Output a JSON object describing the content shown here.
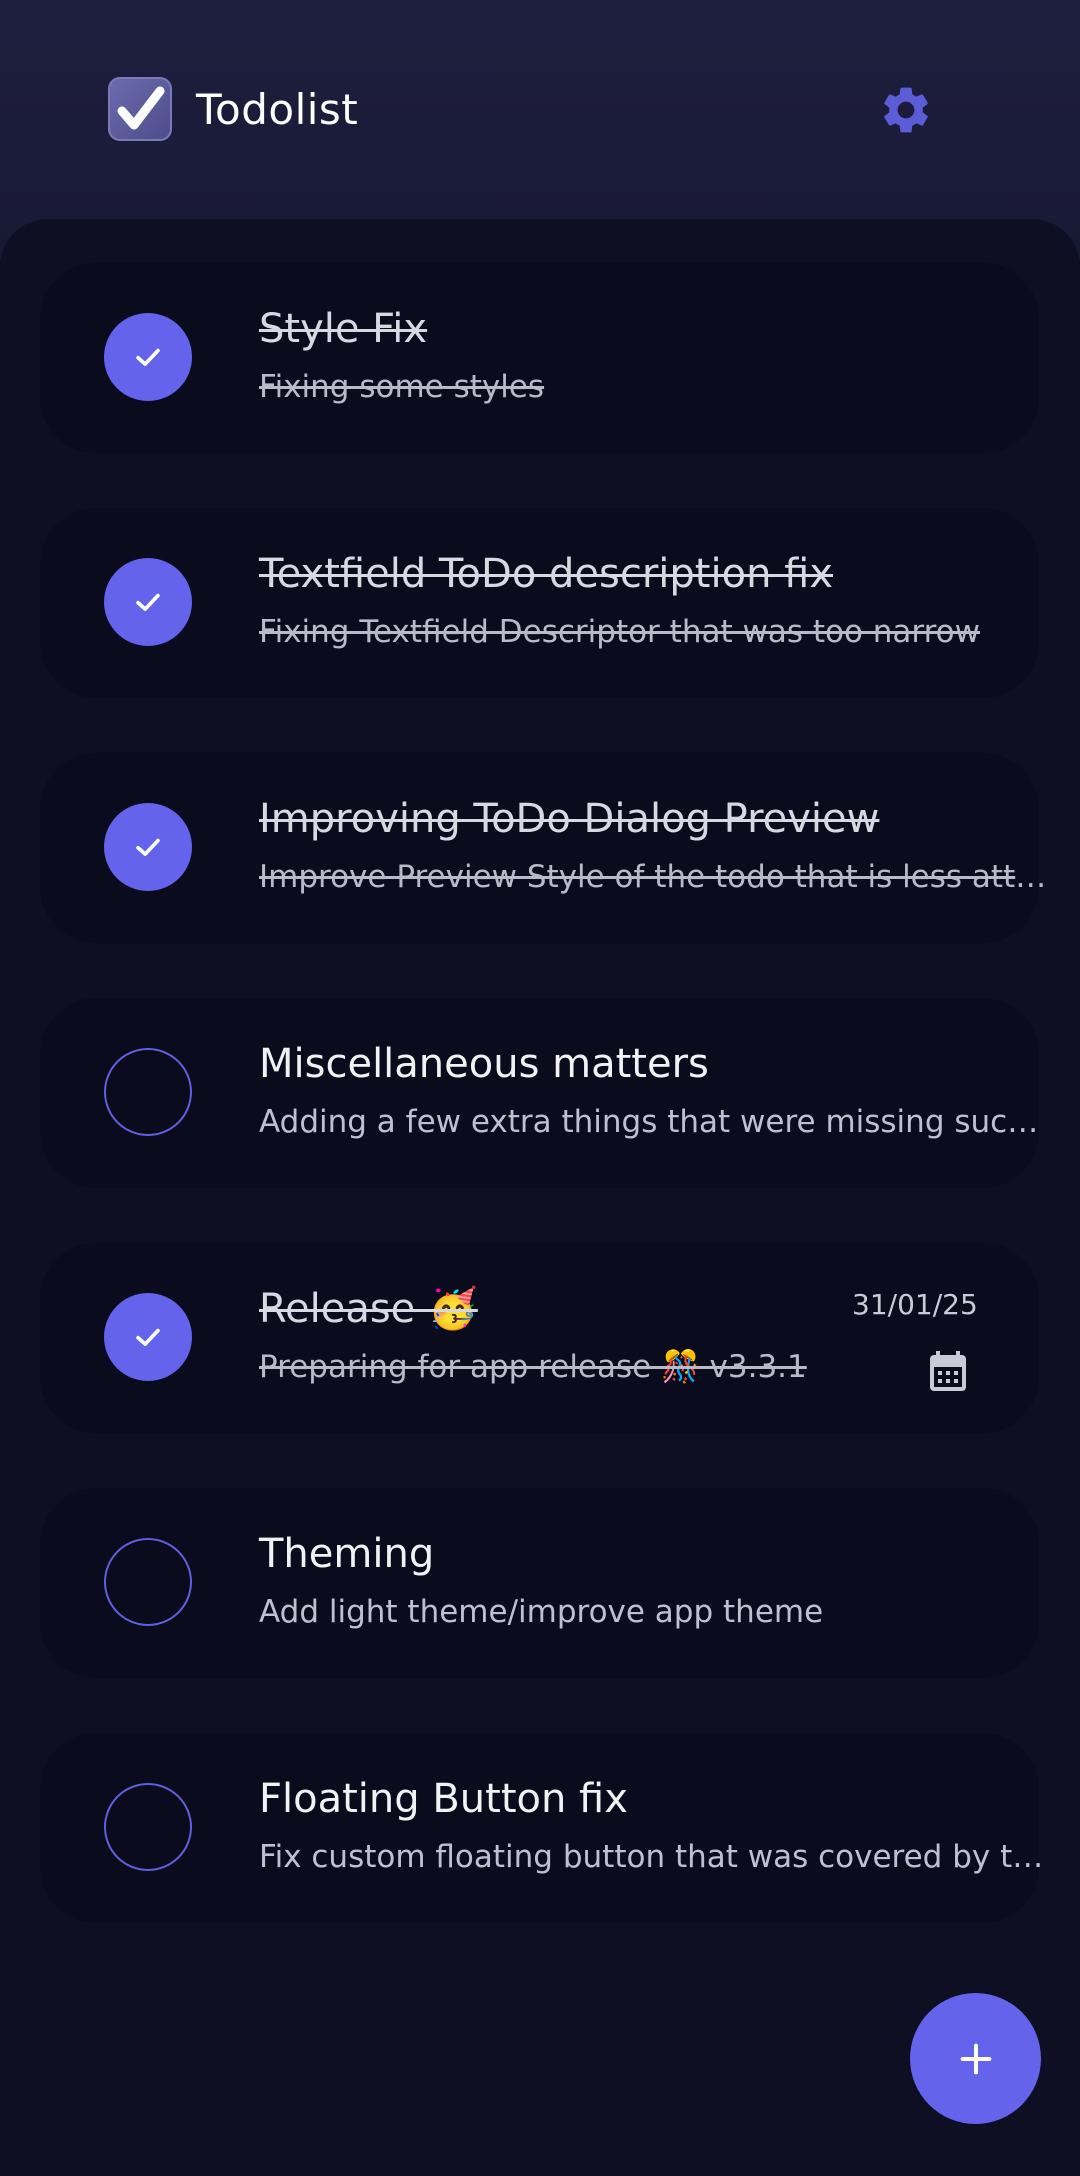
{
  "app": {
    "title": "Todolist",
    "accent_color": "#6363ec",
    "background_color": "#0e0f22",
    "icons": {
      "logo": "checkbox-checked-icon",
      "settings": "gear-icon",
      "complete": "checkmark-icon",
      "due": "calendar-icon",
      "add": "plus-icon"
    }
  },
  "todos": [
    {
      "title": "Style Fix",
      "description": "Fixing some styles",
      "completed": true,
      "due_date": null
    },
    {
      "title": "Textfield ToDo description fix",
      "description": "Fixing Textfield Descriptor that was too narrow",
      "completed": true,
      "due_date": null
    },
    {
      "title": "Improving ToDo Dialog Preview",
      "description": "Improve Preview Style of the todo that is less attr...",
      "completed": true,
      "due_date": null
    },
    {
      "title": "Miscellaneous matters",
      "description": "Adding a few extra things that were missing such...",
      "completed": false,
      "due_date": null
    },
    {
      "title": "Release 🥳",
      "description": "Preparing for app release 🎊 v3.3.1",
      "completed": true,
      "due_date": "31/01/25"
    },
    {
      "title": "Theming",
      "description": "Add light theme/improve app theme",
      "completed": false,
      "due_date": null
    },
    {
      "title": "Floating Button fix",
      "description": "Fix custom floating button that was covered by th...",
      "completed": false,
      "due_date": null
    }
  ]
}
